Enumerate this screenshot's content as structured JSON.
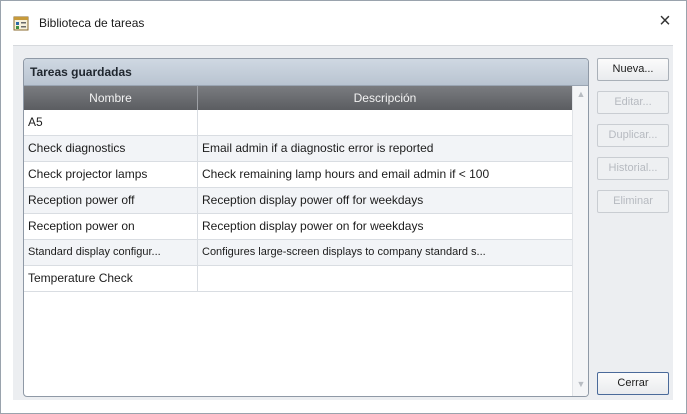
{
  "window": {
    "title": "Biblioteca de tareas",
    "app_icon": "task-library-icon",
    "close_icon": "close-icon",
    "close_glyph": "×"
  },
  "group": {
    "title": "Tareas guardadas"
  },
  "table": {
    "columns": [
      "Nombre",
      "Descripción"
    ],
    "rows": [
      {
        "name": "A5",
        "description": ""
      },
      {
        "name": "Check diagnostics",
        "description": "Email admin if a diagnostic error is reported"
      },
      {
        "name": "Check projector lamps",
        "description": "Check remaining lamp hours and email admin if < 100"
      },
      {
        "name": "Reception power off",
        "description": "Reception display power off for weekdays"
      },
      {
        "name": "Reception power on",
        "description": "Reception display power on for weekdays"
      },
      {
        "name": "Standard display configur...",
        "description": "Configures large-screen displays to company standard s..."
      },
      {
        "name": "Temperature Check",
        "description": ""
      }
    ]
  },
  "buttons": {
    "new": "Nueva...",
    "edit": "Editar...",
    "duplicate": "Duplicar...",
    "history": "Historial...",
    "delete": "Eliminar",
    "close": "Cerrar"
  },
  "scrollbar": {
    "up_glyph": "▲",
    "down_glyph": "▼"
  },
  "colors": {
    "header_dark": "#5b5d61",
    "group_header": "#c3cdd9",
    "background": "#eceef1"
  }
}
